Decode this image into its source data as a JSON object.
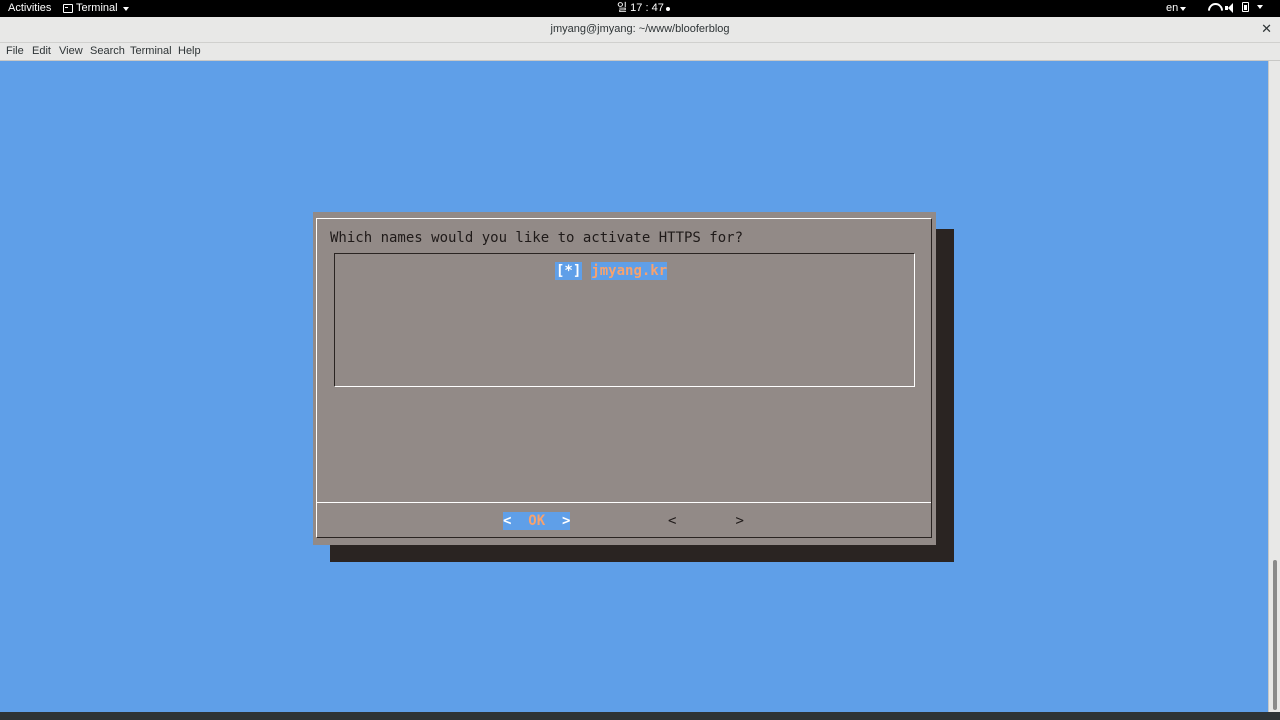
{
  "topbar": {
    "activities": "Activities",
    "app_menu": "Terminal",
    "clock": "일 17 : 47",
    "language": "en"
  },
  "window": {
    "title": "jmyang@jmyang: ~/www/blooferblog",
    "close": "✕"
  },
  "menubar": {
    "file": "File",
    "edit": "Edit",
    "view": "View",
    "search": "Search",
    "terminal": "Terminal",
    "help": "Help"
  },
  "dialog": {
    "prompt": "Which names would you like to activate HTTPS for?",
    "items": [
      {
        "check": "[*]",
        "label": "jmyang.kr"
      }
    ],
    "buttons": {
      "ok_left": "<  ",
      "ok_label": "OK",
      "ok_right": "  >",
      "cancel_left": "<",
      "cancel_label": "       ",
      "cancel_right": ">"
    }
  },
  "colors": {
    "terminal_bg": "#5f9fe8",
    "dialog_bg": "#928a87",
    "shadow": "#2a2422",
    "highlight_text": "#f7a26e"
  }
}
